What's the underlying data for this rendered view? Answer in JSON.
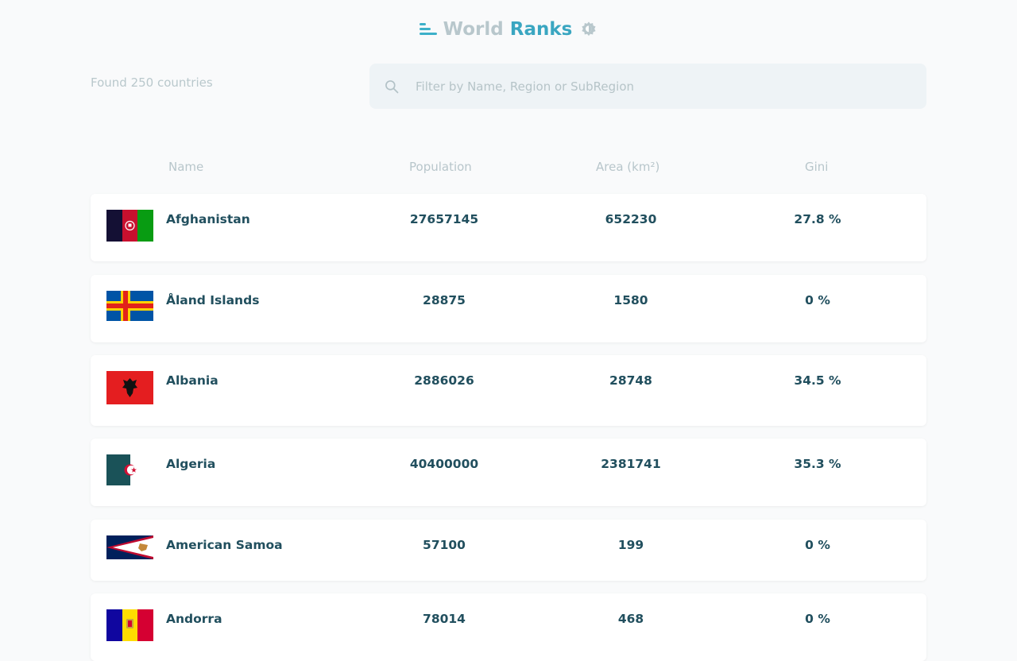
{
  "app": {
    "title_part1": "World",
    "title_part2": "Ranks"
  },
  "found_text": "Found 250 countries",
  "search": {
    "placeholder": "Filter by Name, Region or SubRegion"
  },
  "table": {
    "headers": {
      "name": "Name",
      "population": "Population",
      "area": "Area (km²)",
      "gini": "Gini"
    },
    "rows": [
      {
        "name": "Afghanistan",
        "population": "27657145",
        "area": "652230",
        "gini": "27.8 %"
      },
      {
        "name": "Åland Islands",
        "population": "28875",
        "area": "1580",
        "gini": "0 %"
      },
      {
        "name": "Albania",
        "population": "2886026",
        "area": "28748",
        "gini": "34.5 %"
      },
      {
        "name": "Algeria",
        "population": "40400000",
        "area": "2381741",
        "gini": "35.3 %"
      },
      {
        "name": "American Samoa",
        "population": "57100",
        "area": "199",
        "gini": "0 %"
      },
      {
        "name": "Andorra",
        "population": "78014",
        "area": "468",
        "gini": "0 %"
      }
    ]
  },
  "colors": {
    "accent": "#3aa6c1",
    "muted": "#b8c7cc",
    "text": "#214f5e",
    "search_bg": "#eef3f6"
  }
}
